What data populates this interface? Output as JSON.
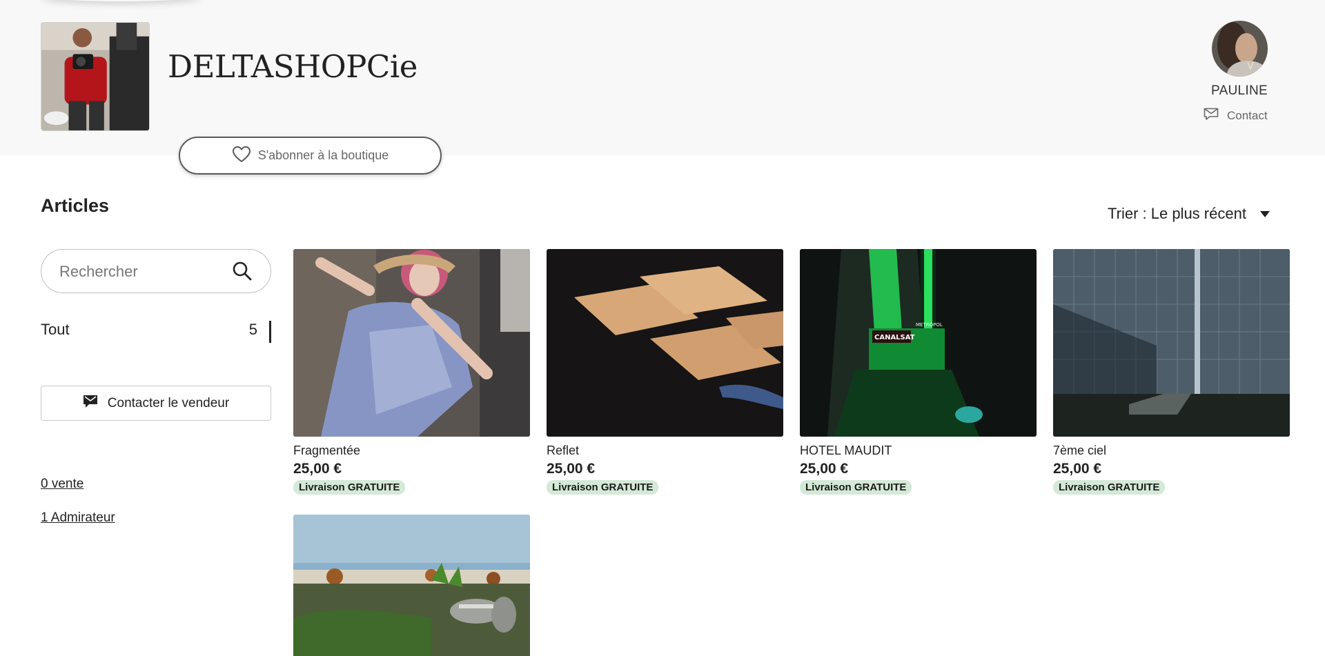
{
  "shop": {
    "name": "DELTASHOPCie",
    "follow_label": "S'abonner à la boutique"
  },
  "owner": {
    "name": "PAULINE",
    "contact_label": "Contact"
  },
  "articles": {
    "title": "Articles",
    "sort_label": "Trier : Le plus récent"
  },
  "sidebar": {
    "search_placeholder": "Rechercher",
    "category": {
      "label": "Tout",
      "count": "5"
    },
    "contact_seller_label": "Contacter le vendeur",
    "sales_label": "0 vente",
    "admirers_label": "1 Admirateur"
  },
  "listings": [
    {
      "title": "Fragmentée",
      "price": "25,00 €",
      "badge": "Livraison GRATUITE"
    },
    {
      "title": "Reflet",
      "price": "25,00 €",
      "badge": "Livraison GRATUITE"
    },
    {
      "title": "HOTEL MAUDIT",
      "price": "25,00 €",
      "badge": "Livraison GRATUITE"
    },
    {
      "title": "7ème ciel",
      "price": "25,00 €",
      "badge": "Livraison GRATUITE"
    },
    {
      "title": "",
      "price": "",
      "badge": ""
    }
  ],
  "photo_signs": {
    "hotel_sign": "CANALSAT",
    "hotel_sign_2": "METROPOL"
  },
  "colors": {
    "hero_bg": "#f8f8f8",
    "badge_bg": "#d4e9d7",
    "text": "#222222"
  }
}
